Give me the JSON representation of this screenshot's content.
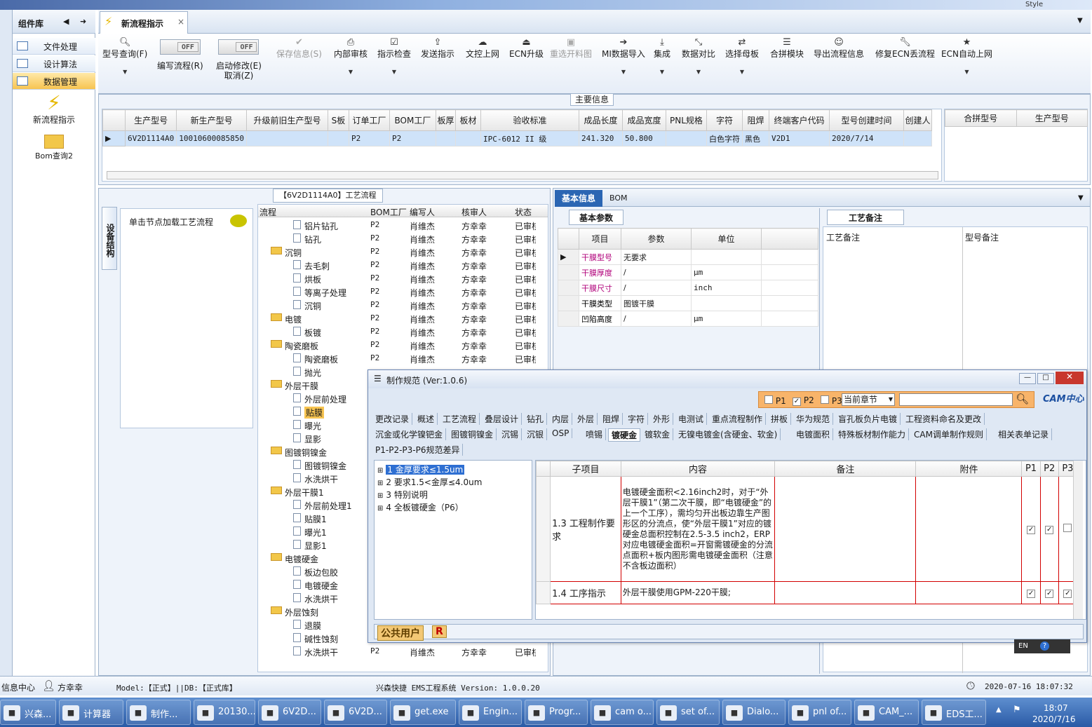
{
  "app": {
    "style_label": "Style"
  },
  "component_library": {
    "title": "组件库",
    "items": [
      {
        "label": "文件处理"
      },
      {
        "label": "设计算法"
      },
      {
        "label": "数据管理"
      }
    ],
    "big_items": [
      {
        "label": "新流程指示"
      },
      {
        "label": "Bom查询2"
      }
    ]
  },
  "tab": {
    "label": "新流程指示",
    "close": "×"
  },
  "ribbon": {
    "buttons": [
      {
        "label": "型号查询(F)",
        "icon": "search-icon"
      },
      {
        "label": "编写流程(R)",
        "toggle": "OFF"
      },
      {
        "label": "启动修改(E)",
        "sub": "取消(Z)",
        "toggle": "OFF"
      },
      {
        "label": "保存信息(S)",
        "icon": "check-icon",
        "disabled": true
      },
      {
        "label": "内部审核",
        "icon": "printer-icon"
      },
      {
        "label": "指示检查",
        "icon": "checkbox-icon"
      },
      {
        "label": "发送指示",
        "icon": "upload-icon"
      },
      {
        "label": "文控上网",
        "icon": "cloud-upload-icon"
      },
      {
        "label": "ECN升级",
        "icon": "eject-icon"
      },
      {
        "label": "重选开料图",
        "icon": "image-icon",
        "disabled": true
      },
      {
        "label": "MI数据导入",
        "icon": "sign-in-icon"
      },
      {
        "label": "集成",
        "icon": "download-icon"
      },
      {
        "label": "数据对比",
        "icon": "compress-icon"
      },
      {
        "label": "选择母板",
        "icon": "shuffle-icon"
      },
      {
        "label": "合拼模块",
        "icon": "list-icon"
      },
      {
        "label": "导出流程信息",
        "icon": "smile-icon"
      },
      {
        "label": "修复ECN丢流程",
        "icon": "wrench-icon"
      },
      {
        "label": "ECN自动上网",
        "icon": "star-icon"
      }
    ]
  },
  "main_info": {
    "title": "主要信息",
    "columns": [
      "生产型号",
      "新生产型号",
      "升级前旧生产型号",
      "S板",
      "订单工厂",
      "BOM工厂",
      "板厚",
      "板材",
      "验收标准",
      "成品长度",
      "成品宽度",
      "PNL规格",
      "字符",
      "阻焊",
      "终端客户代码",
      "型号创建时间",
      "创建人"
    ],
    "row": [
      "6V2D1114A0",
      "10010600085850",
      "",
      "",
      "P2",
      "P2",
      "",
      "",
      "IPC-6012 II 级",
      "241.320",
      "50.800",
      "",
      "白色字符",
      "黑色",
      "V2D1",
      "2020/7/14",
      ""
    ],
    "side_columns": [
      "合拼型号",
      "生产型号"
    ]
  },
  "process": {
    "title": "【6V2D1114A0】工艺流程",
    "vertical_tab": "设备结构",
    "load_hint": "单击节点加载工艺流程",
    "columns": [
      "流程",
      "BOM工厂",
      "编写人",
      "核审人",
      "状态"
    ],
    "rows": [
      {
        "name": "铝片钻孔",
        "folder": false,
        "f": "P2",
        "w": "肖维杰",
        "r": "方幸幸",
        "s": "已审核"
      },
      {
        "name": "钻孔",
        "folder": false,
        "f": "P2",
        "w": "肖维杰",
        "r": "方幸幸",
        "s": "已审核"
      },
      {
        "name": "沉铜",
        "folder": true,
        "f": "P2",
        "w": "肖维杰",
        "r": "方幸幸",
        "s": "已审核"
      },
      {
        "name": "去毛刺",
        "folder": false,
        "f": "P2",
        "w": "肖维杰",
        "r": "方幸幸",
        "s": "已审核"
      },
      {
        "name": "烘板",
        "folder": false,
        "f": "P2",
        "w": "肖维杰",
        "r": "方幸幸",
        "s": "已审核"
      },
      {
        "name": "等离子处理",
        "folder": false,
        "f": "P2",
        "w": "肖维杰",
        "r": "方幸幸",
        "s": "已审核"
      },
      {
        "name": "沉铜",
        "folder": false,
        "f": "P2",
        "w": "肖维杰",
        "r": "方幸幸",
        "s": "已审核"
      },
      {
        "name": "电镀",
        "folder": true,
        "f": "P2",
        "w": "肖维杰",
        "r": "方幸幸",
        "s": "已审核"
      },
      {
        "name": "板镀",
        "folder": false,
        "f": "P2",
        "w": "肖维杰",
        "r": "方幸幸",
        "s": "已审核"
      },
      {
        "name": "陶瓷磨板",
        "folder": true,
        "f": "P2",
        "w": "肖维杰",
        "r": "方幸幸",
        "s": "已审核"
      },
      {
        "name": "陶瓷磨板",
        "folder": false,
        "f": "P2",
        "w": "肖维杰",
        "r": "方幸幸",
        "s": "已审核"
      },
      {
        "name": "抛光",
        "folder": false,
        "f": "",
        "w": "",
        "r": "",
        "s": ""
      },
      {
        "name": "外层干膜",
        "folder": true,
        "f": "",
        "w": "",
        "r": "",
        "s": ""
      },
      {
        "name": "外层前处理",
        "folder": false,
        "f": "",
        "w": "",
        "r": "",
        "s": ""
      },
      {
        "name": "贴膜",
        "folder": false,
        "f": "",
        "w": "",
        "r": "",
        "s": "",
        "sel": true
      },
      {
        "name": "曝光",
        "folder": false,
        "f": "",
        "w": "",
        "r": "",
        "s": ""
      },
      {
        "name": "显影",
        "folder": false,
        "f": "",
        "w": "",
        "r": "",
        "s": ""
      },
      {
        "name": "图镀铜镍金",
        "folder": true,
        "f": "",
        "w": "",
        "r": "",
        "s": ""
      },
      {
        "name": "图镀铜镍金",
        "folder": false,
        "f": "",
        "w": "",
        "r": "",
        "s": ""
      },
      {
        "name": "水洗烘干",
        "folder": false,
        "f": "",
        "w": "",
        "r": "",
        "s": ""
      },
      {
        "name": "外层干膜1",
        "folder": true,
        "f": "",
        "w": "",
        "r": "",
        "s": ""
      },
      {
        "name": "外层前处理1",
        "folder": false,
        "f": "",
        "w": "",
        "r": "",
        "s": ""
      },
      {
        "name": "贴膜1",
        "folder": false,
        "f": "",
        "w": "",
        "r": "",
        "s": ""
      },
      {
        "name": "曝光1",
        "folder": false,
        "f": "",
        "w": "",
        "r": "",
        "s": ""
      },
      {
        "name": "显影1",
        "folder": false,
        "f": "",
        "w": "",
        "r": "",
        "s": ""
      },
      {
        "name": "电镀硬金",
        "folder": true,
        "f": "",
        "w": "",
        "r": "",
        "s": ""
      },
      {
        "name": "板边包胶",
        "folder": false,
        "f": "",
        "w": "",
        "r": "",
        "s": ""
      },
      {
        "name": "电镀硬金",
        "folder": false,
        "f": "",
        "w": "",
        "r": "",
        "s": ""
      },
      {
        "name": "水洗烘干",
        "folder": false,
        "f": "",
        "w": "",
        "r": "",
        "s": ""
      },
      {
        "name": "外层蚀刻",
        "folder": true,
        "f": "",
        "w": "",
        "r": "",
        "s": ""
      },
      {
        "name": "退膜",
        "folder": false,
        "f": "",
        "w": "",
        "r": "",
        "s": ""
      },
      {
        "name": "碱性蚀刻",
        "folder": false,
        "f": "",
        "w": "",
        "r": "",
        "s": ""
      },
      {
        "name": "水洗烘干",
        "folder": false,
        "f": "P2",
        "w": "肖维杰",
        "r": "方幸幸",
        "s": "已审核"
      }
    ]
  },
  "right": {
    "tabs": [
      "基本信息",
      "BOM"
    ],
    "basic_params_title": "基本参数",
    "param_cols": [
      "项目",
      "参数",
      "单位"
    ],
    "params": [
      {
        "item": "干膜型号",
        "value": "无要求",
        "unit": ""
      },
      {
        "item": "干膜厚度",
        "value": "/",
        "unit": "μm"
      },
      {
        "item": "干膜尺寸",
        "value": "/",
        "unit": "inch"
      },
      {
        "item": "干膜类型",
        "value": "图镀干膜",
        "unit": ""
      },
      {
        "item": "凹陷高度",
        "value": "/",
        "unit": "μm"
      }
    ],
    "notes_title": "工艺备注",
    "notes_cols": [
      "工艺备注",
      "型号备注"
    ]
  },
  "dialog": {
    "title": "制作规范 (Ver:1.0.6)",
    "filters": {
      "p1": "P1",
      "p2": "P2",
      "p3": "P3",
      "scope": "当前章节"
    },
    "cam_label": "CAM中心",
    "chapters_row1": [
      "更改记录",
      "概述",
      "工艺流程",
      "叠层设计",
      "钻孔",
      "内层",
      "外层",
      "阻焊",
      "字符",
      "外形",
      "电测试",
      "重点流程制作",
      "拼板",
      "华为规范",
      "盲孔板负片电镀",
      "工程资料命名及更改"
    ],
    "chapters_row2": [
      "沉金或化学镍钯金",
      "图镀铜镍金",
      "沉锡",
      "沉银",
      "OSP",
      "喷锡",
      "镀硬金",
      "镀软金",
      "无镍电镀金(含硬金、软金)",
      "电镀面积",
      "特殊板材制作能力",
      "CAM调单制作规则",
      "相关表单记录"
    ],
    "chapters_row3": [
      "P1-P2-P3-P6规范差异"
    ],
    "tree": [
      "1 金厚要求≤1.5um",
      "2 要求1.5<金厚≤4.0um",
      "3 特别说明",
      "4 全板镀硬金（P6）"
    ],
    "grid_cols": [
      "子项目",
      "内容",
      "备注",
      "附件",
      "P1",
      "P2",
      "P3"
    ],
    "grid_rows": [
      {
        "sub": "1.3 工程制作要求",
        "content": "电镀硬金面积<2.16inch2时，对于“外层干膜1”（第二次干膜，即“电镀硬金”的上一个工序），需均匀开出板边靠生产图形区的分流点，使“外层干膜1”对应的镀硬金总面积控制在2.5-3.5 inch2，ERP对应电镀硬金面积=开窗需镀硬金的分流点面积+板内图形需电镀硬金面积（注意不含板边面积）",
        "p": [
          "✓",
          "✓",
          ""
        ]
      },
      {
        "sub": "1.4 工序指示",
        "content": "外层干膜使用GPM-220干膜;",
        "p": [
          "✓",
          "✓",
          "✓"
        ]
      }
    ],
    "footer_user": "公共用户",
    "footer_r": "R"
  },
  "status": {
    "info_center": "信息中心",
    "user": "方幸幸",
    "model": "Model:【正式】||DB:【正式库】",
    "system": "兴森快捷 EMS工程系统 Version: 1.0.0.20",
    "datetime": "2020-07-16 18:07:32"
  },
  "taskbar": {
    "items": [
      "兴森...",
      "计算器",
      "制作...",
      "20130...",
      "6V2D...",
      "6V2D...",
      "get.exe",
      "Engin...",
      "Progr...",
      "cam o...",
      "set of...",
      "Dialo...",
      "pnl of...",
      "CAM_...",
      "EDS工..."
    ],
    "time": "18:07",
    "date": "2020/7/16",
    "ime": "EN"
  }
}
